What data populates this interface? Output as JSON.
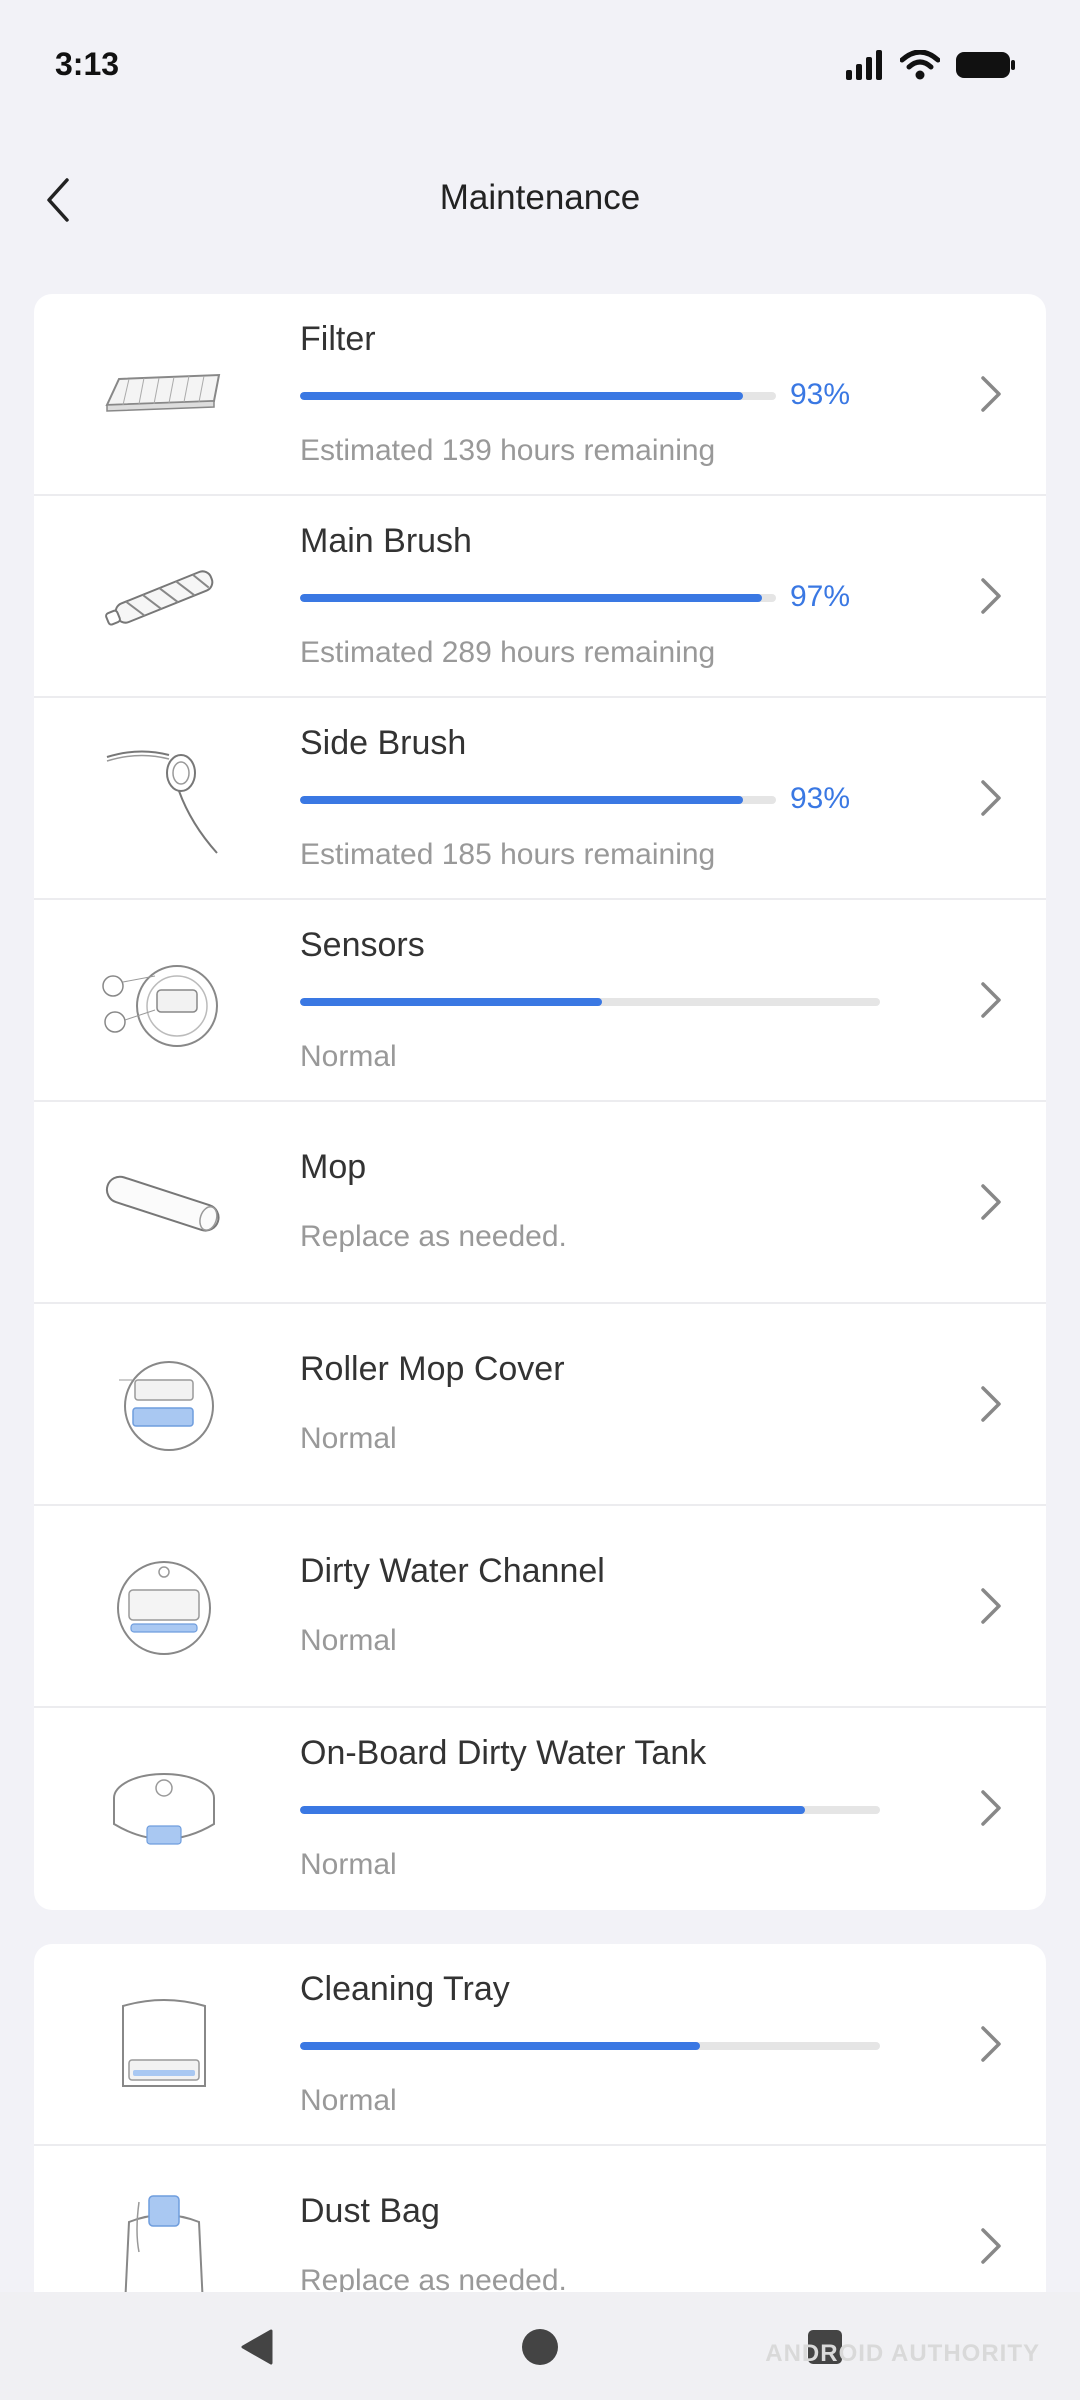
{
  "status_bar": {
    "time": "3:13"
  },
  "header": {
    "title": "Maintenance"
  },
  "items": [
    {
      "name": "Filter",
      "progress": 0.93,
      "percent": "93%",
      "status": "Estimated 139 hours remaining"
    },
    {
      "name": "Main Brush",
      "progress": 0.97,
      "percent": "97%",
      "status": "Estimated 289 hours remaining"
    },
    {
      "name": "Side Brush",
      "progress": 0.93,
      "percent": "93%",
      "status": "Estimated 185 hours remaining"
    },
    {
      "name": "Sensors",
      "progress": 0.52,
      "status": "Normal"
    },
    {
      "name": "Mop",
      "status": "Replace as needed."
    },
    {
      "name": "Roller Mop Cover",
      "status": "Normal"
    },
    {
      "name": "Dirty Water Channel",
      "status": "Normal"
    },
    {
      "name": "On-Board Dirty Water Tank",
      "progress": 0.87,
      "status": "Normal"
    }
  ],
  "items2": [
    {
      "name": "Cleaning Tray",
      "progress": 0.69,
      "status": "Normal"
    },
    {
      "name": "Dust Bag",
      "status": "Replace as needed."
    }
  ],
  "watermark": "ANDROID AUTHORITY",
  "colors": {
    "accent": "#3a78e3",
    "track": "#e5e5e5",
    "background": "#f2f2f7"
  }
}
